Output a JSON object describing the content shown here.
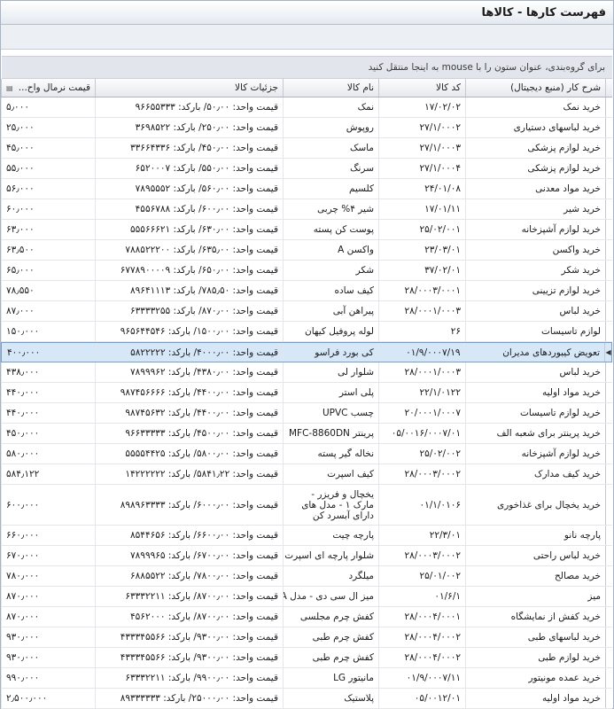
{
  "window": {
    "title": "فهرست کارها - کالاها"
  },
  "group_panel": {
    "hint": "برای گروه‌بندی، عنوان ستون را با mouse به اینجا منتقل کنید"
  },
  "columns": {
    "work_desc": "شرح کار (منبع دیجیتال)",
    "code": "کد کالا",
    "name": "نام کالا",
    "details": "جزئیات کالا",
    "price": "قیمت نرمال واح..."
  },
  "rows": [
    {
      "desc": "خرید نمک",
      "code": "۱۷/۰۲/۰۲",
      "name": "نمک",
      "details": "قیمت واحد: ۵۰٫۰۰/ بارکد: ۹۶۶۵۵۳۳۳",
      "price": "۵٫۰۰۰"
    },
    {
      "desc": "خرید لباسهای دستیاری",
      "code": "۲۷/۱/۰۰۰۲",
      "name": "روپوش",
      "details": "قیمت واحد: ۲۵۰٫۰۰/ بارکد: ۳۶۹۸۵۲۲",
      "price": "۲۵٫۰۰۰"
    },
    {
      "desc": "خرید لوازم پزشکی",
      "code": "۲۷/۱/۰۰۰۳",
      "name": "ماسک",
      "details": "قیمت واحد: ۴۵۰٫۰۰/ بارکد: ۳۳۶۶۴۳۳۶",
      "price": "۴۵٫۰۰۰"
    },
    {
      "desc": "خرید لوازم پزشکی",
      "code": "۲۷/۱/۰۰۰۴",
      "name": "سرنگ",
      "details": "قیمت واحد: ۵۵۰٫۰۰/ بارکد: ۶۵۲۰۰۰۷",
      "price": "۵۵٫۰۰۰"
    },
    {
      "desc": "خرید مواد معدنی",
      "code": "۲۴/۰۱/۰۸",
      "name": "کلسیم",
      "details": "قیمت واحد: ۵۶۰٫۰۰/ بارکد: ۷۸۹۵۵۵۲",
      "price": "۵۶٫۰۰۰"
    },
    {
      "desc": "خرید شیر",
      "code": "۱۷/۰۱/۱۱",
      "name": "شیر ۴% چربی",
      "details": "قیمت واحد: ۶۰۰٫۰۰/ بارکد: ۴۵۵۶۷۸۸",
      "price": "۶۰٫۰۰۰"
    },
    {
      "desc": "خرید لوازم آشپزخانه",
      "code": "۲۵/۰۲/۰۰۱",
      "name": "پوست کن پسته",
      "details": "قیمت واحد: ۶۳۰٫۰۰/ بارکد: ۵۵۵۶۶۶۲۱",
      "price": "۶۳٫۰۰۰"
    },
    {
      "desc": "خرید واکسن",
      "code": "۲۳/۰۳/۰۱",
      "name": "واکسن A",
      "details": "قیمت واحد: ۶۳۵٫۰۰/ بارکد: ۷۸۸۵۲۲۲۰۰",
      "price": "۶۳٫۵۰۰"
    },
    {
      "desc": "خرید شکر",
      "code": "۳۷/۰۲/۰۱",
      "name": "شکر",
      "details": "قیمت واحد: ۶۵۰٫۰۰/ بارکد: ۶۷۷۸۹۰۰۰۰۹",
      "price": "۶۵٫۰۰۰"
    },
    {
      "desc": "خرید لوازم تزیینی",
      "code": "۲۸/۰۰۰۳/۰۰۰۱",
      "name": "کیف ساده",
      "details": "قیمت واحد: ۷۸۵٫۵۰/ بارکد: ۸۹۶۴۱۱۱۳",
      "price": "۷۸٫۵۵۰"
    },
    {
      "desc": "خرید لباس",
      "code": "۲۸/۰۰۰۱/۰۰۰۳",
      "name": "پیراهن آبی",
      "details": "قیمت واحد: ۸۷۰٫۰۰/ بارکد: ۶۳۳۳۳۲۵۵",
      "price": "۸۷٫۰۰۰"
    },
    {
      "desc": "لوازم تاسیسات",
      "code": "۲۶",
      "name": "لوله پروفیل کیهان",
      "details": "قیمت واحد: ۱۵۰۰٫۰۰/ بارکد: ۹۶۵۶۴۴۵۴۶",
      "price": "۱۵۰٫۰۰۰"
    },
    {
      "desc": "تعویض کیبوردهای مدیران",
      "code": "۰۱/۹/۰۰۰۷/۱۹",
      "name": "کی بورد فراسو",
      "details": "قیمت واحد: ۴۰۰۰٫۰۰/ بارکد: ۵۸۲۲۲۲۲",
      "price": "۴۰۰٫۰۰۰",
      "selected": true
    },
    {
      "desc": "خرید لباس",
      "code": "۲۸/۰۰۰۱/۰۰۰۳",
      "name": "شلوار لی",
      "details": "قیمت واحد: ۴۳۸۰٫۰۰/ بارکد: ۷۸۹۹۹۶۲",
      "price": "۴۳۸٫۰۰۰"
    },
    {
      "desc": "خرید مواد اولیه",
      "code": "۲۲/۱/۰۱۲۲",
      "name": "پلی استر",
      "details": "قیمت واحد: ۴۴۰۰٫۰۰/ بارکد: ۹۸۷۴۵۶۶۶۶",
      "price": "۴۴۰٫۰۰۰"
    },
    {
      "desc": "خرید لوازم تاسیسات",
      "code": "۲۰/۰۰۰۱/۰۰۰۷",
      "name": "چسب UPVC",
      "details": "قیمت واحد: ۴۴۰۰٫۰۰/ بارکد: ۹۸۷۴۵۶۳۲",
      "price": "۴۴۰٫۰۰۰"
    },
    {
      "desc": "خرید پرینتر برای شعبه الف",
      "code": "۰۵/۰۰۱۶/۰۰۰۷/۰۱",
      "name": "پرینتر MFC-8860DN",
      "details": "قیمت واحد: ۴۵۰۰٫۰۰/ بارکد: ۹۶۶۳۳۳۳۳",
      "price": "۴۵۰٫۰۰۰"
    },
    {
      "desc": "خرید لوازم آشپزخانه",
      "code": "۲۵/۰۲/۰۰۲",
      "name": "نخاله گیر پسته",
      "details": "قیمت واحد: ۵۸۰۰٫۰۰/ بارکد: ۵۵۵۵۴۴۲۵",
      "price": "۵۸۰٫۰۰۰"
    },
    {
      "desc": "خرید کیف مدارک",
      "code": "۲۸/۰۰۰۳/۰۰۰۲",
      "name": "کیف اسپرت",
      "details": "قیمت واحد: ۵۸۴۱٫۲۲/ بارکد: ۱۴۲۲۲۲۲۲",
      "price": "۵۸۴٫۱۲۲"
    },
    {
      "desc": "خرید یخچال برای غذاخوری",
      "code": "۰۱/۱/۰۱۰۶",
      "name": "یخچال و فریزر - مارک ۱ - مدل های دارای آبسرد کن",
      "details": "قیمت واحد: ۶۰۰۰٫۰۰/ بارکد: ۸۹۸۹۶۳۳۳۳",
      "price": "۶۰۰٫۰۰۰",
      "tall": true
    },
    {
      "desc": "پارچه نانو",
      "code": "۲۲/۳/۰۱",
      "name": "پارچه چیت",
      "details": "قیمت واحد: ۶۶۰۰٫۰۰/ بارکد: ۸۵۴۴۶۵۶",
      "price": "۶۶۰٫۰۰۰"
    },
    {
      "desc": "خرید لباس راحتی",
      "code": "۲۸/۰۰۰۳/۰۰۰۲",
      "name": "شلوار پارچه ای اسپرت",
      "details": "قیمت واحد: ۶۷۰۰٫۰۰/ بارکد: ۷۸۹۹۹۶۵",
      "price": "۶۷۰٫۰۰۰"
    },
    {
      "desc": "خرید مصالح",
      "code": "۲۵/۰۱/۰۰۲",
      "name": "میلگرد",
      "details": "قیمت واحد: ۷۸۰۰٫۰۰/ بارکد: ۶۸۸۵۵۲۲",
      "price": "۷۸۰٫۰۰۰"
    },
    {
      "desc": "میز",
      "code": "۰۱/۶/۱",
      "name": "میز ال سی دی - مدل A",
      "details": "قیمت واحد: ۸۷۰۰٫۰۰/ بارکد: ۶۳۳۳۲۲۱۱",
      "price": "۸۷۰٫۰۰۰"
    },
    {
      "desc": "خرید کفش از نمایشگاه",
      "code": "۲۸/۰۰۰۴/۰۰۰۱",
      "name": "کفش چرم مجلسی",
      "details": "قیمت واحد: ۸۷۰۰٫۰۰/ بارکد: ۴۵۶۲۰۰۰",
      "price": "۸۷۰٫۰۰۰"
    },
    {
      "desc": "خرید لباسهای طبی",
      "code": "۲۸/۰۰۰۴/۰۰۰۲",
      "name": "کفش چرم طبی",
      "details": "قیمت واحد: ۹۳۰۰٫۰۰/ بارکد: ۴۳۳۳۴۵۵۶۶",
      "price": "۹۳۰٫۰۰۰"
    },
    {
      "desc": "خرید لوازم طبی",
      "code": "۲۸/۰۰۰۴/۰۰۰۲",
      "name": "کفش چرم طبی",
      "details": "قیمت واحد: ۹۳۰۰٫۰۰/ بارکد: ۴۳۳۳۴۵۵۶۶",
      "price": "۹۳۰٫۰۰۰"
    },
    {
      "desc": "خرید عمده مونیتور",
      "code": "۰۱/۹/۰۰۰۷/۱۱",
      "name": "مانیتور LG",
      "details": "قیمت واحد: ۹۹۰۰٫۰۰/ بارکد: ۶۳۳۳۲۲۱۱",
      "price": "۹۹۰٫۰۰۰"
    },
    {
      "desc": "خرید مواد اولیه",
      "code": "۰۵/۰۰۱۲/۰۱",
      "name": "پلاستیک",
      "details": "قیمت واحد: ۲۵۰۰۰٫۰۰/ بارکد: ۸۹۳۳۳۳۳۳",
      "price": "۲٫۵۰۰٫۰۰۰"
    }
  ]
}
